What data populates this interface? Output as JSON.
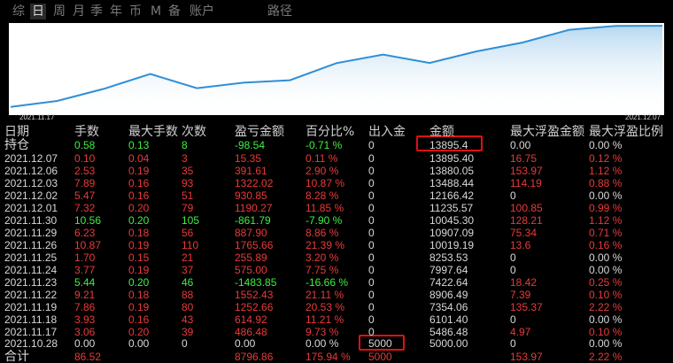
{
  "period_tabs": [
    {
      "label": "综",
      "active": false
    },
    {
      "label": "日",
      "active": true
    },
    {
      "label": "周",
      "active": false
    },
    {
      "label": "月",
      "active": false
    },
    {
      "label": "季",
      "active": false
    },
    {
      "label": "年",
      "active": false
    },
    {
      "label": "币",
      "active": false
    },
    {
      "label": "M",
      "active": false
    },
    {
      "label": "备",
      "active": false
    },
    {
      "label": "账户",
      "active": false
    }
  ],
  "right_tab": "路径",
  "chart_data": {
    "type": "line",
    "x": [
      "2021.11.17",
      "2021.11.18",
      "2021.11.19",
      "2021.11.22",
      "2021.11.23",
      "2021.11.24",
      "2021.11.25",
      "2021.11.26",
      "2021.11.29",
      "2021.11.30",
      "2021.12.01",
      "2021.12.02",
      "2021.12.03",
      "2021.12.06",
      "2021.12.07"
    ],
    "values": [
      5486.48,
      6101.4,
      7354.06,
      8906.49,
      7422.64,
      7997.64,
      8253.53,
      10019.19,
      10907.09,
      10045.3,
      11235.57,
      12166.42,
      13488.44,
      13880.05,
      13895.4
    ],
    "x_start_label": "2021.11.17",
    "x_end_label": "2021.12.07",
    "colors": {
      "line": "#2f8fd6",
      "fill_top": "#2f8fd6",
      "fill_bottom": "#ffffff",
      "background": "#ffffff"
    }
  },
  "table": {
    "headers": [
      "日期",
      "手数",
      "最大手数",
      "次数",
      "盈亏金额",
      "百分比%",
      "出入金",
      "金额",
      "最大浮盈金额",
      "最大浮盈比例"
    ],
    "rows": [
      {
        "c": [
          "持仓",
          "0.58",
          "0.13",
          "8",
          "-98.54",
          "-0.71 %",
          "0",
          "13895.4",
          "0.00",
          "0.00 %"
        ],
        "s": [
          "w",
          "g",
          "g",
          "g",
          "g",
          "g",
          "w",
          "w",
          "w",
          "w"
        ]
      },
      {
        "c": [
          "2021.12.07",
          "0.10",
          "0.04",
          "3",
          "15.35",
          "0.11 %",
          "0",
          "13895.40",
          "16.75",
          "0.12 %"
        ],
        "s": [
          "w",
          "r",
          "r",
          "r",
          "r",
          "r",
          "w",
          "w",
          "r",
          "r"
        ]
      },
      {
        "c": [
          "2021.12.06",
          "2.53",
          "0.19",
          "35",
          "391.61",
          "2.90 %",
          "0",
          "13880.05",
          "153.97",
          "1.12 %"
        ],
        "s": [
          "w",
          "r",
          "r",
          "r",
          "r",
          "r",
          "w",
          "w",
          "r",
          "r"
        ]
      },
      {
        "c": [
          "2021.12.03",
          "7.89",
          "0.16",
          "93",
          "1322.02",
          "10.87 %",
          "0",
          "13488.44",
          "114.19",
          "0.88 %"
        ],
        "s": [
          "w",
          "r",
          "r",
          "r",
          "r",
          "r",
          "w",
          "w",
          "r",
          "r"
        ]
      },
      {
        "c": [
          "2021.12.02",
          "5.47",
          "0.16",
          "51",
          "930.85",
          "8.28 %",
          "0",
          "12166.42",
          "0",
          "0.00 %"
        ],
        "s": [
          "w",
          "r",
          "r",
          "r",
          "r",
          "r",
          "w",
          "w",
          "w",
          "w"
        ]
      },
      {
        "c": [
          "2021.12.01",
          "7.32",
          "0.20",
          "79",
          "1190.27",
          "11.85 %",
          "0",
          "11235.57",
          "100.85",
          "0.99 %"
        ],
        "s": [
          "w",
          "r",
          "r",
          "r",
          "r",
          "r",
          "w",
          "w",
          "r",
          "r"
        ]
      },
      {
        "c": [
          "2021.11.30",
          "10.56",
          "0.20",
          "105",
          "-861.79",
          "-7.90 %",
          "0",
          "10045.30",
          "128.21",
          "1.12 %"
        ],
        "s": [
          "w",
          "g",
          "g",
          "g",
          "g",
          "g",
          "w",
          "w",
          "r",
          "r"
        ]
      },
      {
        "c": [
          "2021.11.29",
          "6.23",
          "0.18",
          "56",
          "887.90",
          "8.86 %",
          "0",
          "10907.09",
          "75.34",
          "0.71 %"
        ],
        "s": [
          "w",
          "r",
          "r",
          "r",
          "r",
          "r",
          "w",
          "w",
          "r",
          "r"
        ]
      },
      {
        "c": [
          "2021.11.26",
          "10.87",
          "0.19",
          "110",
          "1765.66",
          "21.39 %",
          "0",
          "10019.19",
          "13.6",
          "0.16 %"
        ],
        "s": [
          "w",
          "r",
          "r",
          "r",
          "r",
          "r",
          "w",
          "w",
          "r",
          "r"
        ]
      },
      {
        "c": [
          "2021.11.25",
          "1.70",
          "0.15",
          "21",
          "255.89",
          "3.20 %",
          "0",
          "8253.53",
          "0",
          "0.00 %"
        ],
        "s": [
          "w",
          "r",
          "r",
          "r",
          "r",
          "r",
          "w",
          "w",
          "w",
          "w"
        ]
      },
      {
        "c": [
          "2021.11.24",
          "3.77",
          "0.19",
          "37",
          "575.00",
          "7.75 %",
          "0",
          "7997.64",
          "0",
          "0.00 %"
        ],
        "s": [
          "w",
          "r",
          "r",
          "r",
          "r",
          "r",
          "w",
          "w",
          "w",
          "w"
        ]
      },
      {
        "c": [
          "2021.11.23",
          "5.44",
          "0.20",
          "46",
          "-1483.85",
          "-16.66 %",
          "0",
          "7422.64",
          "18.42",
          "0.25 %"
        ],
        "s": [
          "w",
          "g",
          "g",
          "g",
          "g",
          "g",
          "w",
          "w",
          "r",
          "r"
        ]
      },
      {
        "c": [
          "2021.11.22",
          "9.21",
          "0.18",
          "88",
          "1552.43",
          "21.11 %",
          "0",
          "8906.49",
          "7.39",
          "0.10 %"
        ],
        "s": [
          "w",
          "r",
          "r",
          "r",
          "r",
          "r",
          "w",
          "w",
          "r",
          "r"
        ]
      },
      {
        "c": [
          "2021.11.19",
          "7.86",
          "0.19",
          "80",
          "1252.66",
          "20.53 %",
          "0",
          "7354.06",
          "135.37",
          "2.22 %"
        ],
        "s": [
          "w",
          "r",
          "r",
          "r",
          "r",
          "r",
          "w",
          "w",
          "r",
          "r"
        ]
      },
      {
        "c": [
          "2021.11.18",
          "3.93",
          "0.16",
          "43",
          "614.92",
          "11.21 %",
          "0",
          "6101.40",
          "0",
          "0.00 %"
        ],
        "s": [
          "w",
          "r",
          "r",
          "r",
          "r",
          "r",
          "w",
          "w",
          "w",
          "w"
        ]
      },
      {
        "c": [
          "2021.11.17",
          "3.06",
          "0.20",
          "39",
          "486.48",
          "9.73 %",
          "0",
          "5486.48",
          "4.97",
          "0.10 %"
        ],
        "s": [
          "w",
          "r",
          "r",
          "r",
          "r",
          "r",
          "w",
          "w",
          "r",
          "r"
        ]
      },
      {
        "c": [
          "2021.10.28",
          "0.00",
          "0.00",
          "0",
          "0.00",
          "0.00 %",
          "5000",
          "5000.00",
          "0",
          "0.00 %"
        ],
        "s": [
          "w",
          "w",
          "w",
          "w",
          "w",
          "w",
          "w",
          "w",
          "w",
          "w"
        ]
      },
      {
        "c": [
          "合计",
          "86.52",
          "",
          "",
          "8796.86",
          "175.94 %",
          "5000",
          "",
          "153.97",
          "2.22 %"
        ],
        "s": [
          "w",
          "r",
          "r",
          "r",
          "r",
          "r",
          "r",
          "w",
          "r",
          "r"
        ]
      }
    ]
  },
  "colors": {
    "background": "#000000",
    "header": "#cfcfcf",
    "neutral": "#d8d8d8",
    "profit": "#e83a3a",
    "loss": "#3ff03f",
    "highlight": "#e01010"
  }
}
